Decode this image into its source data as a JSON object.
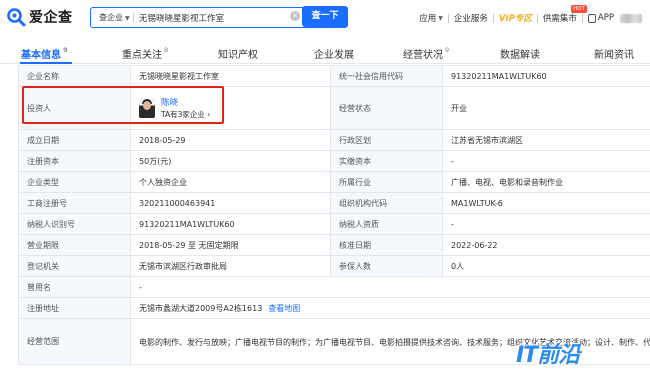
{
  "header": {
    "logo_text": "爱企查",
    "search_scope": "查企业",
    "search_value": "无锡晓晓星影视工作室",
    "search_button": "查一下",
    "nav": {
      "apply": "应用",
      "enterprise_service": "企业服务",
      "vip": "VIP专区",
      "supply_market": "供需集市",
      "hot_badge": "HOT",
      "app": "APP"
    }
  },
  "tabs": [
    {
      "label": "基本信息",
      "count": "9"
    },
    {
      "label": "重点关注",
      "count": "8"
    },
    {
      "label": "知识产权",
      "count": ""
    },
    {
      "label": "企业发展",
      "count": ""
    },
    {
      "label": "经营状况",
      "count": "9"
    },
    {
      "label": "数据解读",
      "count": ""
    },
    {
      "label": "新闻资讯",
      "count": ""
    }
  ],
  "info": {
    "company_name_label": "企业名称",
    "company_name": "无锡晓晓星影视工作室",
    "credit_code_label": "统一社会信用代码",
    "credit_code": "91320211MA1WLTUK60",
    "investor_label": "投资人",
    "investor_name": "陈晓",
    "investor_companies": "TA有3家企业 ›",
    "status_label": "经营状态",
    "status": "开业",
    "founded_label": "成立日期",
    "founded": "2018-05-29",
    "region_label": "行政区划",
    "region": "江苏省无锡市滨湖区",
    "reg_capital_label": "注册资本",
    "reg_capital": "50万(元)",
    "paid_capital_label": "实缴资本",
    "paid_capital": "-",
    "type_label": "企业类型",
    "type": "个人独资企业",
    "industry_label": "所属行业",
    "industry": "广播、电视、电影和录音制作业",
    "reg_no_label": "工商注册号",
    "reg_no": "320211000463941",
    "org_code_label": "组织机构代码",
    "org_code": "MA1WLTUK-6",
    "taxpayer_id_label": "纳税人识别号",
    "taxpayer_id": "91320211MA1WLTUK60",
    "taxpayer_qual_label": "纳税人资质",
    "taxpayer_qual": "-",
    "term_label": "营业期限",
    "term": "2018-05-29 至 无固定期限",
    "approval_label": "核准日期",
    "approval": "2022-06-22",
    "authority_label": "登记机关",
    "authority": "无锡市滨湖区行政审批局",
    "insured_label": "参保人数",
    "insured": "0人",
    "former_name_label": "曾用名",
    "former_name": "-",
    "address_label": "注册地址",
    "address": "无锡市蠡湖大道2009号A2栋1613",
    "map_link": "查看地图",
    "scope_label": "经营范围",
    "scope": "电影的制作、发行与放映；广播电视节目的制作；为广播电视节目、电影拍摄提供技术咨询、技术服务；组织文化艺术交流活动；设计、制作、代理和发布国内广告业务；影视文化信息咨询；企业形象策划服务；知识产权服务；影视策划。（依法须经批准的项目，经相关部门批准后方可开展经营活动）"
  },
  "watermark": "IT前沿",
  "colors": {
    "brand": "#1a6dff",
    "highlight": "#e0241a",
    "label_bg": "#f5f8fc",
    "vip": "#f0b020"
  }
}
